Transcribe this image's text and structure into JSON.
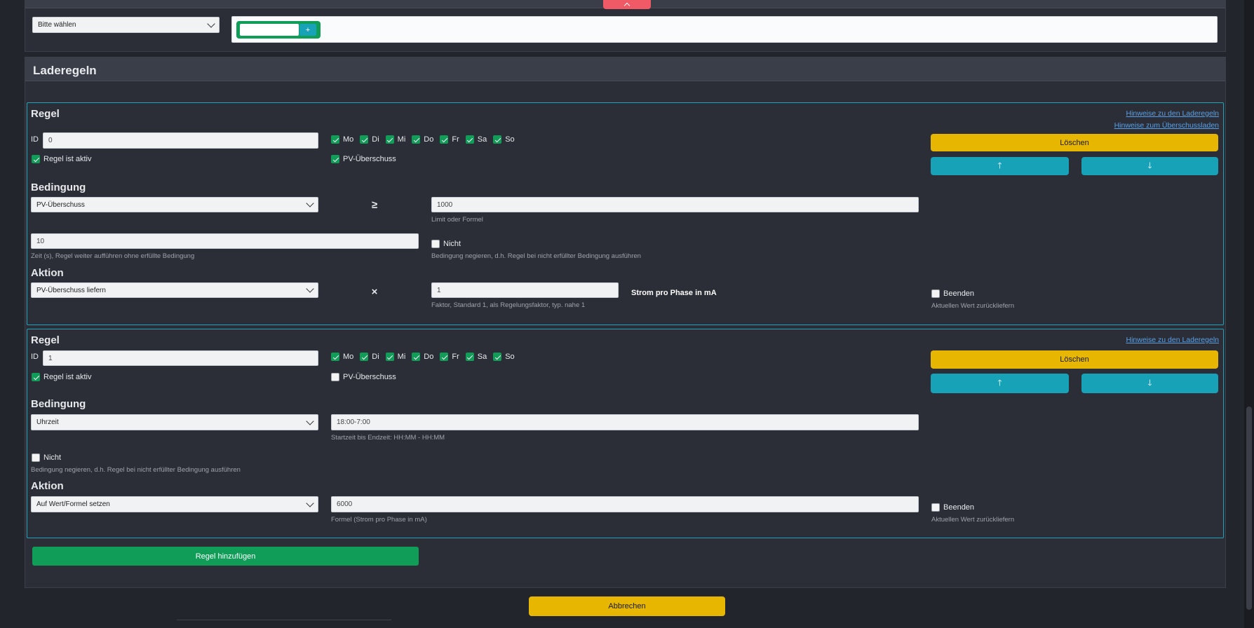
{
  "top": {
    "tab_icon": "chevron-up-icon",
    "user_select": "Bitte wählen",
    "add_button": "+"
  },
  "section": {
    "title": "Laderegeln"
  },
  "days": [
    "Mo",
    "Di",
    "Mi",
    "Do",
    "Fr",
    "Sa",
    "So"
  ],
  "rule1": {
    "title": "Regel",
    "id_label": "ID",
    "id_value": "0",
    "active_label": "Regel ist aktiv",
    "pv_label": "PV-Überschuss",
    "link_rules": "Hinweise zu den Laderegeln",
    "link_surplus": "Hinweise zum Überschussladen",
    "delete": "Löschen",
    "condition_title": "Bedingung",
    "condition_select": "PV-Überschuss",
    "operator": "≥",
    "limit_value": "1000",
    "limit_help": "Limit oder Formel",
    "time_value": "10",
    "time_help": "Zeit (s), Regel weiter aufführen ohne erfüllte Bedingung",
    "not_label": "Nicht",
    "not_help": "Bedingung negieren, d.h. Regel bei nicht erfüllter Bedingung ausführen",
    "action_title": "Aktion",
    "action_select": "PV-Überschuss liefern",
    "action_operator": "×",
    "factor_value": "1",
    "factor_help": "Faktor, Standard 1, als Regelungsfaktor, typ. nahe 1",
    "unit_label": "Strom pro Phase in mA",
    "end_label": "Beenden",
    "end_help": "Aktuellen Wert zurückliefern"
  },
  "rule2": {
    "title": "Regel",
    "id_label": "ID",
    "id_value": "1",
    "active_label": "Regel ist aktiv",
    "pv_label": "PV-Überschuss",
    "link_rules": "Hinweise zu den Laderegeln",
    "delete": "Löschen",
    "condition_title": "Bedingung",
    "condition_select": "Uhrzeit",
    "time_range_value": "18:00-7:00",
    "time_range_help": "Startzeit bis Endzeit: HH:MM - HH:MM",
    "not_label": "Nicht",
    "not_help": "Bedingung negieren, d.h. Regel bei nicht erfüllter Bedingung ausführen",
    "action_title": "Aktion",
    "action_select": "Auf Wert/Formel setzen",
    "formula_value": "6000",
    "formula_help": "Formel (Strom pro Phase in mA)",
    "end_label": "Beenden",
    "end_help": "Aktuellen Wert zurückliefern"
  },
  "buttons": {
    "add_rule": "Regel hinzufügen",
    "cancel": "Abbrechen"
  },
  "colors": {
    "accent_green": "#0f9d58",
    "accent_yellow": "#e6b600",
    "accent_cyan": "#17a2b8",
    "danger_red": "#f05a67"
  }
}
